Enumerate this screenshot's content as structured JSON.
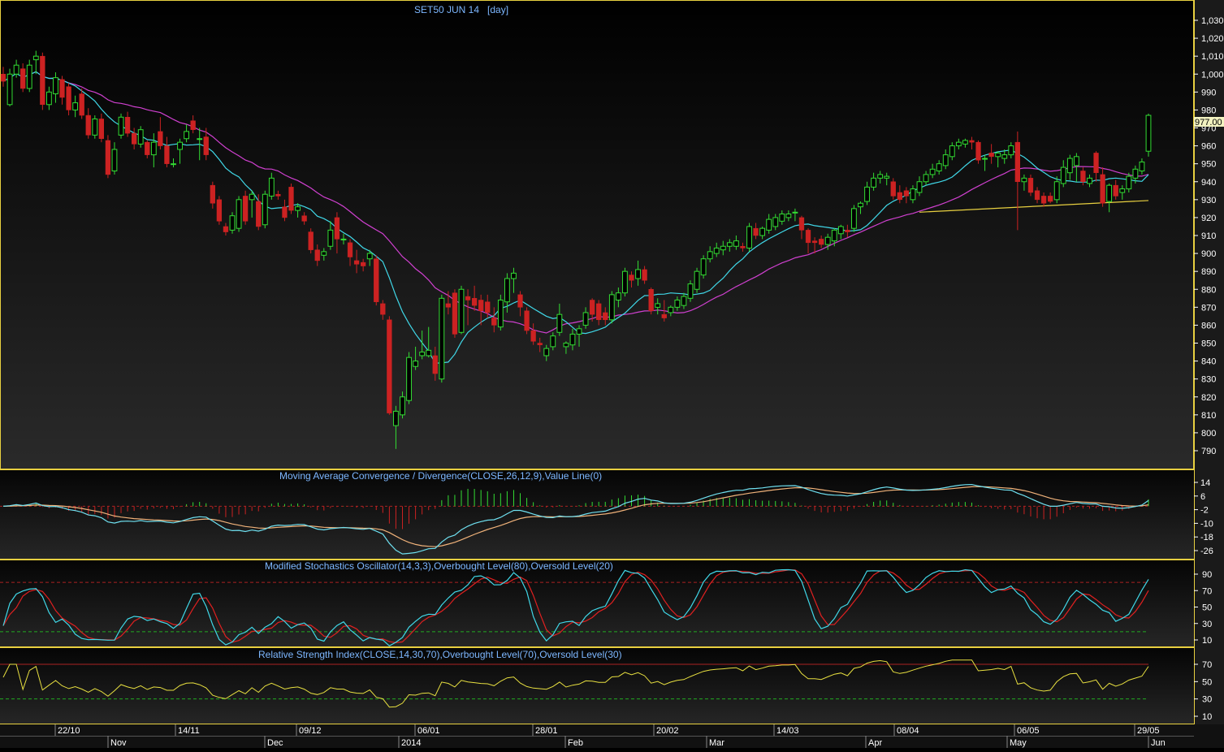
{
  "chart_data": {
    "type": "candlestick",
    "title": "SET50 JUN 14   [day]",
    "last_price_label": "977.00",
    "price_axis": {
      "ylim": [
        785,
        1035
      ],
      "ticks": [
        790,
        800,
        810,
        820,
        830,
        840,
        850,
        860,
        870,
        880,
        890,
        900,
        910,
        920,
        930,
        940,
        950,
        960,
        970,
        980,
        990,
        1000,
        1010,
        1020,
        1030
      ],
      "tick_labels": [
        "790",
        "800",
        "810",
        "820",
        "830",
        "840",
        "850",
        "860",
        "870",
        "880",
        "890",
        "900",
        "910",
        "920",
        "930",
        "940",
        "950",
        "960",
        "970",
        "980",
        "990",
        "1,000",
        "1,010",
        "1,020",
        "1,030"
      ]
    },
    "candles": [
      {
        "o": 1000,
        "h": 1004,
        "l": 993,
        "c": 996
      },
      {
        "o": 983,
        "h": 1003,
        "l": 982,
        "c": 1000
      },
      {
        "o": 1000,
        "h": 1008,
        "l": 998,
        "c": 1005
      },
      {
        "o": 1003,
        "h": 1006,
        "l": 990,
        "c": 992
      },
      {
        "o": 992,
        "h": 1008,
        "l": 990,
        "c": 1005
      },
      {
        "o": 1008,
        "h": 1013,
        "l": 1000,
        "c": 1010
      },
      {
        "o": 1010,
        "h": 1012,
        "l": 980,
        "c": 983
      },
      {
        "o": 983,
        "h": 993,
        "l": 980,
        "c": 990
      },
      {
        "o": 989,
        "h": 1001,
        "l": 984,
        "c": 998
      },
      {
        "o": 997,
        "h": 999,
        "l": 983,
        "c": 987
      },
      {
        "o": 993,
        "h": 995,
        "l": 977,
        "c": 980
      },
      {
        "o": 980,
        "h": 988,
        "l": 976,
        "c": 984
      },
      {
        "o": 989,
        "h": 992,
        "l": 975,
        "c": 977
      },
      {
        "o": 977,
        "h": 981,
        "l": 964,
        "c": 966
      },
      {
        "o": 966,
        "h": 977,
        "l": 964,
        "c": 975
      },
      {
        "o": 975,
        "h": 978,
        "l": 962,
        "c": 964
      },
      {
        "o": 963,
        "h": 966,
        "l": 942,
        "c": 944
      },
      {
        "o": 946,
        "h": 962,
        "l": 944,
        "c": 958
      },
      {
        "o": 966,
        "h": 978,
        "l": 964,
        "c": 976
      },
      {
        "o": 976,
        "h": 979,
        "l": 965,
        "c": 967
      },
      {
        "o": 967,
        "h": 970,
        "l": 958,
        "c": 961
      },
      {
        "o": 961,
        "h": 971,
        "l": 959,
        "c": 969
      },
      {
        "o": 962,
        "h": 963,
        "l": 953,
        "c": 955
      },
      {
        "o": 955,
        "h": 967,
        "l": 948,
        "c": 962
      },
      {
        "o": 968,
        "h": 976,
        "l": 958,
        "c": 960
      },
      {
        "o": 960,
        "h": 965,
        "l": 948,
        "c": 950
      },
      {
        "o": 950,
        "h": 953,
        "l": 948,
        "c": 950
      },
      {
        "o": 958,
        "h": 964,
        "l": 950,
        "c": 962
      },
      {
        "o": 964,
        "h": 972,
        "l": 962,
        "c": 968
      },
      {
        "o": 974,
        "h": 977,
        "l": 967,
        "c": 969
      },
      {
        "o": 964,
        "h": 970,
        "l": 952,
        "c": 964
      },
      {
        "o": 965,
        "h": 970,
        "l": 952,
        "c": 955
      },
      {
        "o": 938,
        "h": 940,
        "l": 925,
        "c": 928
      },
      {
        "o": 930,
        "h": 932,
        "l": 916,
        "c": 918
      },
      {
        "o": 915,
        "h": 917,
        "l": 910,
        "c": 912
      },
      {
        "o": 913,
        "h": 923,
        "l": 911,
        "c": 921
      },
      {
        "o": 914,
        "h": 932,
        "l": 912,
        "c": 930
      },
      {
        "o": 932,
        "h": 935,
        "l": 916,
        "c": 918
      },
      {
        "o": 930,
        "h": 935,
        "l": 920,
        "c": 933
      },
      {
        "o": 929,
        "h": 933,
        "l": 913,
        "c": 915
      },
      {
        "o": 916,
        "h": 935,
        "l": 914,
        "c": 933
      },
      {
        "o": 932,
        "h": 945,
        "l": 930,
        "c": 942
      },
      {
        "o": 933,
        "h": 935,
        "l": 930,
        "c": 932
      },
      {
        "o": 926,
        "h": 930,
        "l": 918,
        "c": 920
      },
      {
        "o": 937,
        "h": 939,
        "l": 922,
        "c": 924
      },
      {
        "o": 924,
        "h": 928,
        "l": 920,
        "c": 926
      },
      {
        "o": 921,
        "h": 923,
        "l": 916,
        "c": 918
      },
      {
        "o": 912,
        "h": 914,
        "l": 900,
        "c": 902
      },
      {
        "o": 902,
        "h": 905,
        "l": 893,
        "c": 896
      },
      {
        "o": 899,
        "h": 903,
        "l": 896,
        "c": 901
      },
      {
        "o": 904,
        "h": 918,
        "l": 902,
        "c": 913
      },
      {
        "o": 920,
        "h": 923,
        "l": 900,
        "c": 908
      },
      {
        "o": 908,
        "h": 911,
        "l": 905,
        "c": 908
      },
      {
        "o": 906,
        "h": 908,
        "l": 893,
        "c": 898
      },
      {
        "o": 896,
        "h": 902,
        "l": 889,
        "c": 894
      },
      {
        "o": 895,
        "h": 897,
        "l": 890,
        "c": 893
      },
      {
        "o": 897,
        "h": 902,
        "l": 893,
        "c": 900
      },
      {
        "o": 897,
        "h": 899,
        "l": 871,
        "c": 873
      },
      {
        "o": 872,
        "h": 874,
        "l": 863,
        "c": 866
      },
      {
        "o": 863,
        "h": 865,
        "l": 810,
        "c": 811
      },
      {
        "o": 804,
        "h": 815,
        "l": 791,
        "c": 812
      },
      {
        "o": 810,
        "h": 823,
        "l": 808,
        "c": 820
      },
      {
        "o": 818,
        "h": 845,
        "l": 816,
        "c": 842
      },
      {
        "o": 837,
        "h": 848,
        "l": 835,
        "c": 840
      },
      {
        "o": 843,
        "h": 857,
        "l": 841,
        "c": 845
      },
      {
        "o": 843,
        "h": 859,
        "l": 842,
        "c": 846
      },
      {
        "o": 843,
        "h": 848,
        "l": 829,
        "c": 833
      },
      {
        "o": 830,
        "h": 877,
        "l": 828,
        "c": 875
      },
      {
        "o": 872,
        "h": 879,
        "l": 866,
        "c": 870
      },
      {
        "o": 878,
        "h": 880,
        "l": 853,
        "c": 855
      },
      {
        "o": 856,
        "h": 882,
        "l": 855,
        "c": 880
      },
      {
        "o": 876,
        "h": 880,
        "l": 860,
        "c": 874
      },
      {
        "o": 875,
        "h": 882,
        "l": 868,
        "c": 871
      },
      {
        "o": 874,
        "h": 877,
        "l": 860,
        "c": 868
      },
      {
        "o": 873,
        "h": 877,
        "l": 864,
        "c": 867
      },
      {
        "o": 864,
        "h": 870,
        "l": 856,
        "c": 860
      },
      {
        "o": 859,
        "h": 877,
        "l": 857,
        "c": 874
      },
      {
        "o": 873,
        "h": 889,
        "l": 867,
        "c": 886
      },
      {
        "o": 886,
        "h": 892,
        "l": 878,
        "c": 889
      },
      {
        "o": 877,
        "h": 879,
        "l": 865,
        "c": 870
      },
      {
        "o": 868,
        "h": 870,
        "l": 855,
        "c": 857
      },
      {
        "o": 857,
        "h": 861,
        "l": 849,
        "c": 851
      },
      {
        "o": 850,
        "h": 853,
        "l": 845,
        "c": 849
      },
      {
        "o": 843,
        "h": 849,
        "l": 840,
        "c": 847
      },
      {
        "o": 848,
        "h": 856,
        "l": 846,
        "c": 854
      },
      {
        "o": 856,
        "h": 872,
        "l": 854,
        "c": 866
      },
      {
        "o": 848,
        "h": 851,
        "l": 844,
        "c": 850
      },
      {
        "o": 849,
        "h": 858,
        "l": 846,
        "c": 855
      },
      {
        "o": 855,
        "h": 860,
        "l": 848,
        "c": 858
      },
      {
        "o": 860,
        "h": 870,
        "l": 858,
        "c": 867
      },
      {
        "o": 874,
        "h": 875,
        "l": 862,
        "c": 866
      },
      {
        "o": 872,
        "h": 874,
        "l": 860,
        "c": 863
      },
      {
        "o": 867,
        "h": 870,
        "l": 860,
        "c": 863
      },
      {
        "o": 863,
        "h": 879,
        "l": 861,
        "c": 877
      },
      {
        "o": 874,
        "h": 881,
        "l": 870,
        "c": 878
      },
      {
        "o": 878,
        "h": 892,
        "l": 876,
        "c": 890
      },
      {
        "o": 888,
        "h": 890,
        "l": 881,
        "c": 885
      },
      {
        "o": 886,
        "h": 896,
        "l": 882,
        "c": 891
      },
      {
        "o": 891,
        "h": 893,
        "l": 883,
        "c": 885
      },
      {
        "o": 880,
        "h": 881,
        "l": 866,
        "c": 868
      },
      {
        "o": 870,
        "h": 875,
        "l": 866,
        "c": 872
      },
      {
        "o": 866,
        "h": 874,
        "l": 862,
        "c": 864
      },
      {
        "o": 867,
        "h": 871,
        "l": 865,
        "c": 870
      },
      {
        "o": 870,
        "h": 876,
        "l": 868,
        "c": 874
      },
      {
        "o": 871,
        "h": 878,
        "l": 869,
        "c": 876
      },
      {
        "o": 875,
        "h": 885,
        "l": 873,
        "c": 883
      },
      {
        "o": 880,
        "h": 892,
        "l": 878,
        "c": 890
      },
      {
        "o": 888,
        "h": 899,
        "l": 886,
        "c": 897
      },
      {
        "o": 897,
        "h": 904,
        "l": 895,
        "c": 901
      },
      {
        "o": 900,
        "h": 906,
        "l": 898,
        "c": 903
      },
      {
        "o": 902,
        "h": 907,
        "l": 899,
        "c": 904
      },
      {
        "o": 904,
        "h": 908,
        "l": 901,
        "c": 906
      },
      {
        "o": 904,
        "h": 910,
        "l": 902,
        "c": 907
      },
      {
        "o": 904,
        "h": 906,
        "l": 901,
        "c": 903
      },
      {
        "o": 903,
        "h": 917,
        "l": 901,
        "c": 915
      },
      {
        "o": 914,
        "h": 917,
        "l": 908,
        "c": 910
      },
      {
        "o": 910,
        "h": 915,
        "l": 908,
        "c": 914
      },
      {
        "o": 913,
        "h": 922,
        "l": 911,
        "c": 919
      },
      {
        "o": 915,
        "h": 922,
        "l": 913,
        "c": 920
      },
      {
        "o": 918,
        "h": 924,
        "l": 916,
        "c": 922
      },
      {
        "o": 920,
        "h": 924,
        "l": 918,
        "c": 922
      },
      {
        "o": 923,
        "h": 925,
        "l": 918,
        "c": 923
      },
      {
        "o": 920,
        "h": 921,
        "l": 908,
        "c": 913
      },
      {
        "o": 913,
        "h": 914,
        "l": 900,
        "c": 906
      },
      {
        "o": 907,
        "h": 909,
        "l": 900,
        "c": 906
      },
      {
        "o": 908,
        "h": 910,
        "l": 903,
        "c": 905
      },
      {
        "o": 905,
        "h": 911,
        "l": 902,
        "c": 909
      },
      {
        "o": 907,
        "h": 914,
        "l": 904,
        "c": 913
      },
      {
        "o": 911,
        "h": 916,
        "l": 908,
        "c": 915
      },
      {
        "o": 913,
        "h": 916,
        "l": 909,
        "c": 912
      },
      {
        "o": 914,
        "h": 927,
        "l": 912,
        "c": 925
      },
      {
        "o": 926,
        "h": 929,
        "l": 922,
        "c": 928
      },
      {
        "o": 929,
        "h": 940,
        "l": 927,
        "c": 937
      },
      {
        "o": 937,
        "h": 945,
        "l": 935,
        "c": 942
      },
      {
        "o": 942,
        "h": 946,
        "l": 939,
        "c": 944
      },
      {
        "o": 942,
        "h": 945,
        "l": 938,
        "c": 943
      },
      {
        "o": 940,
        "h": 942,
        "l": 930,
        "c": 932
      },
      {
        "o": 934,
        "h": 938,
        "l": 928,
        "c": 930
      },
      {
        "o": 935,
        "h": 937,
        "l": 928,
        "c": 932
      },
      {
        "o": 930,
        "h": 938,
        "l": 928,
        "c": 936
      },
      {
        "o": 934,
        "h": 943,
        "l": 932,
        "c": 940
      },
      {
        "o": 940,
        "h": 946,
        "l": 938,
        "c": 944
      },
      {
        "o": 944,
        "h": 950,
        "l": 942,
        "c": 947
      },
      {
        "o": 946,
        "h": 952,
        "l": 944,
        "c": 950
      },
      {
        "o": 949,
        "h": 958,
        "l": 947,
        "c": 955
      },
      {
        "o": 954,
        "h": 962,
        "l": 952,
        "c": 960
      },
      {
        "o": 960,
        "h": 964,
        "l": 958,
        "c": 962
      },
      {
        "o": 961,
        "h": 964,
        "l": 959,
        "c": 963
      },
      {
        "o": 963,
        "h": 965,
        "l": 958,
        "c": 962
      },
      {
        "o": 962,
        "h": 963,
        "l": 950,
        "c": 952
      },
      {
        "o": 953,
        "h": 955,
        "l": 946,
        "c": 953
      },
      {
        "o": 956,
        "h": 961,
        "l": 950,
        "c": 954
      },
      {
        "o": 954,
        "h": 957,
        "l": 948,
        "c": 956
      },
      {
        "o": 953,
        "h": 958,
        "l": 950,
        "c": 955
      },
      {
        "o": 955,
        "h": 962,
        "l": 953,
        "c": 960
      },
      {
        "o": 962,
        "h": 968,
        "l": 913,
        "c": 940
      },
      {
        "o": 940,
        "h": 944,
        "l": 935,
        "c": 942
      },
      {
        "o": 942,
        "h": 944,
        "l": 932,
        "c": 934
      },
      {
        "o": 935,
        "h": 937,
        "l": 928,
        "c": 930
      },
      {
        "o": 932,
        "h": 934,
        "l": 926,
        "c": 928
      },
      {
        "o": 932,
        "h": 934,
        "l": 928,
        "c": 929
      },
      {
        "o": 930,
        "h": 943,
        "l": 928,
        "c": 940
      },
      {
        "o": 939,
        "h": 952,
        "l": 937,
        "c": 948
      },
      {
        "o": 945,
        "h": 955,
        "l": 941,
        "c": 953
      },
      {
        "o": 949,
        "h": 956,
        "l": 940,
        "c": 954
      },
      {
        "o": 946,
        "h": 948,
        "l": 938,
        "c": 940
      },
      {
        "o": 939,
        "h": 944,
        "l": 937,
        "c": 942
      },
      {
        "o": 956,
        "h": 957,
        "l": 940,
        "c": 945
      },
      {
        "o": 944,
        "h": 948,
        "l": 926,
        "c": 928
      },
      {
        "o": 929,
        "h": 939,
        "l": 923,
        "c": 938
      },
      {
        "o": 938,
        "h": 941,
        "l": 930,
        "c": 932
      },
      {
        "o": 934,
        "h": 938,
        "l": 930,
        "c": 936
      },
      {
        "o": 936,
        "h": 945,
        "l": 934,
        "c": 943
      },
      {
        "o": 942,
        "h": 949,
        "l": 939,
        "c": 947
      },
      {
        "o": 946,
        "h": 953,
        "l": 944,
        "c": 951
      },
      {
        "o": 957,
        "h": 978,
        "l": 954,
        "c": 977
      }
    ],
    "date_axis": {
      "ticks": [
        "22/10",
        "14/11",
        "09/12",
        "06/01",
        "28/01",
        "20/02",
        "14/03",
        "08/04",
        "06/05",
        "29/05"
      ],
      "months": [
        "Nov",
        "Dec",
        "2014",
        "Feb",
        "Mar",
        "Apr",
        "May",
        "Jun"
      ]
    },
    "macd": {
      "title": "Moving Average Convergence / Divergence(CLOSE,26,12,9),Value Line(0)",
      "ylim": [
        -32,
        20
      ],
      "ticks": [
        "14",
        "6",
        "-2",
        "-10",
        "-18",
        "-26"
      ],
      "series": [
        {
          "name": "MACD",
          "color": "#6fe0f0"
        },
        {
          "name": "Signal",
          "color": "#f0b27a"
        }
      ]
    },
    "stochastic": {
      "title": "Modified Stochastics Oscillator(14,3,3),Overbought Level(80),Oversold Level(20)",
      "ylim": [
        0,
        100
      ],
      "ticks": [
        "90",
        "70",
        "50",
        "30",
        "10"
      ],
      "overbought": 80,
      "oversold": 20
    },
    "rsi": {
      "title": "Relative Strength Index(CLOSE,14,30,70),Overbought Level(70),Oversold Level(30)",
      "ylim": [
        0,
        90
      ],
      "ticks": [
        "70",
        "50",
        "30",
        "10"
      ],
      "overbought": 70,
      "oversold": 30
    },
    "colors": {
      "up": "#33dd33",
      "down": "#cc2222",
      "ma_fast": "#40d8e8",
      "ma_slow": "#d040d0",
      "support": "#e8d040",
      "border": "#e8d040",
      "text": "#7db7ff",
      "axis_text": "#ffffff"
    }
  }
}
